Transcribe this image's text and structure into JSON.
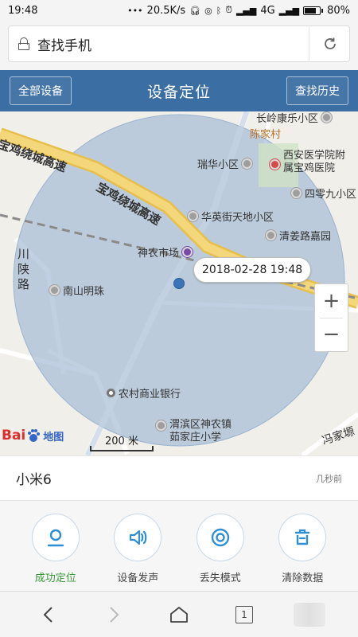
{
  "status_bar": {
    "time": "19:48",
    "net_speed": "20.5K/s",
    "network": "4G",
    "battery": "80%",
    "battery_level": 0.8
  },
  "address_bar": {
    "text": "查找手机",
    "lock_icon": "lock-icon",
    "reload_icon": "reload-icon"
  },
  "header": {
    "left_button": "全部设备",
    "title": "设备定位",
    "right_button": "查找历史",
    "bg_color": "#3b6ea3"
  },
  "map": {
    "timestamp": "2018-02-28 19:48",
    "road_labels": [
      "宝鸡绕城高速",
      "宝鸡绕城高速",
      "川陕路",
      "冯家塬"
    ],
    "pois": [
      "长岭康乐小区",
      "陈家村",
      "瑞华小区",
      "西安医学院附属宝鸡医院",
      "四零九小区",
      "华英街天地小区",
      "清姜路嘉园",
      "神农市场",
      "南山明珠",
      "农村商业银行",
      "渭滨区神农镇茹家庄小学"
    ],
    "zoom_in": "+",
    "zoom_out": "−",
    "scale": "200 米",
    "logo": {
      "left": "Bai",
      "right": "地图"
    },
    "accuracy_circle_color": "#a7bdd6"
  },
  "device": {
    "name": "小米6",
    "updated": "几秒前"
  },
  "actions": [
    {
      "label": "成功定位",
      "icon": "location-pin-icon"
    },
    {
      "label": "设备发声",
      "icon": "speaker-icon"
    },
    {
      "label": "丢失模式",
      "icon": "target-icon"
    },
    {
      "label": "清除数据",
      "icon": "trash-icon"
    }
  ],
  "bottom_nav": {
    "tab_count": "1"
  }
}
